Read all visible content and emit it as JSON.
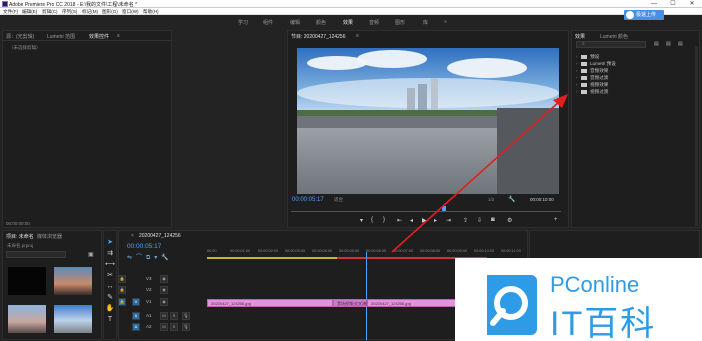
{
  "window": {
    "title": "Adobe Premiere Pro CC 2018 - E:\\我的文件\\工程\\未命名 *",
    "minimize": "—",
    "maximize": "☐",
    "close": "✕"
  },
  "menu": [
    "文件(F)",
    "编辑(E)",
    "剪辑(C)",
    "序列(S)",
    "标记(M)",
    "图形(G)",
    "窗口(W)",
    "帮助(H)"
  ],
  "workspaces": [
    {
      "label": "学习",
      "active": false
    },
    {
      "label": "组件",
      "active": false
    },
    {
      "label": "编辑",
      "active": false
    },
    {
      "label": "颜色",
      "active": false
    },
    {
      "label": "效果",
      "active": true
    },
    {
      "label": "音频",
      "active": false
    },
    {
      "label": "图形",
      "active": false
    },
    {
      "label": "库",
      "active": false
    },
    {
      "label": "»",
      "active": false
    }
  ],
  "badge": "极速上传",
  "left_panel": {
    "tabs": [
      "源：(无剪辑)",
      "Lumetri 范围",
      "效果控件"
    ],
    "menu_icon": "≡",
    "header": "（未选择剪辑）",
    "timecode": "00:00:00:00"
  },
  "program": {
    "title": "节目: 20200427_124256",
    "menu_icon": "≡",
    "timecode": "00:00:05:17",
    "fit": "适合",
    "quality": "1/2",
    "duration": "00:00:10:00"
  },
  "effects_panel": {
    "tabs": [
      "效果",
      "Lumetri 颜色"
    ],
    "items": [
      "预设",
      "Lumetri 预设",
      "音频效果",
      "音频过渡",
      "视频效果",
      "视频过渡"
    ]
  },
  "project": {
    "tabs": [
      "项目: 未命名",
      "媒体浏览器"
    ],
    "file": "未命名.prproj",
    "items": [
      "",
      "",
      "",
      ""
    ]
  },
  "timeline": {
    "tab": "20200427_124256",
    "timecode": "00:00:05:17",
    "ruler": [
      "00:00",
      "00:00:01:00",
      "00:00:02:00",
      "00:00:03:00",
      "00:00:04:00",
      "00:00:05:00",
      "00:00:06:00",
      "00:00:07:00",
      "00:00:08:00",
      "00:00:09:00",
      "00:00:10:00",
      "00:00:11:00"
    ],
    "tracks": [
      "V3",
      "V2",
      "V1",
      "A1",
      "A2"
    ],
    "clips": [
      {
        "label": "20200427_124256.jpg"
      },
      {
        "label": "黑场视频/交叉溶解"
      },
      {
        "label": "20200427_124256.jpg"
      }
    ]
  },
  "watermark": {
    "brand": "PConline",
    "text": "IT百科"
  },
  "colors": {
    "accent": "#4aa3ff",
    "clip": "#e98fe0",
    "arrow": "#e02020"
  }
}
